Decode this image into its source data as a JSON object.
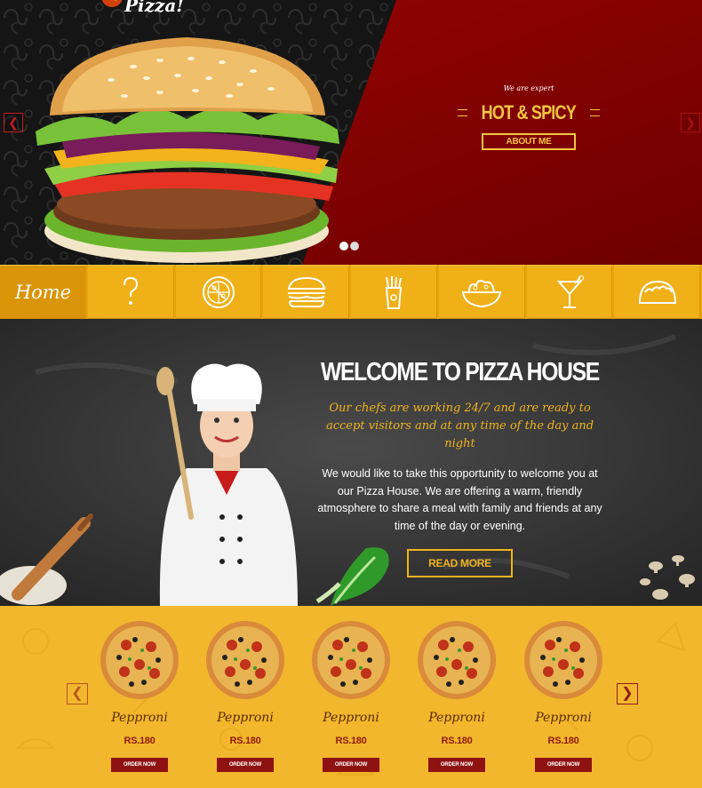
{
  "hero": {
    "logo_text": "Pizza!",
    "kicker": "We are expert",
    "title": "HOT & SPICY",
    "button_label": "ABOUT ME",
    "prev_icon": "chevron-left-icon",
    "next_icon": "chevron-right-icon",
    "slides_total": 2,
    "slide_active": 1,
    "colors": {
      "accent": "#f4c542",
      "red": "#8e0000"
    }
  },
  "categories": [
    {
      "label": "Home",
      "icon": "home-text",
      "active": true
    },
    {
      "label": "",
      "icon": "question-icon"
    },
    {
      "label": "",
      "icon": "pizza-icon"
    },
    {
      "label": "",
      "icon": "burger-icon"
    },
    {
      "label": "",
      "icon": "fries-icon"
    },
    {
      "label": "",
      "icon": "salad-bowl-icon"
    },
    {
      "label": "",
      "icon": "cocktail-icon"
    },
    {
      "label": "",
      "icon": "taco-icon"
    }
  ],
  "welcome": {
    "title": "WELCOME TO PIZZA HOUSE",
    "subtitle": "Our chefs are working 24/7 and are ready to accept visitors and at any time of the day and night",
    "body": "We would like to take this opportunity to welcome you at our Pizza House. We are offering a warm, friendly atmosphere to share a meal with family and friends at any time of the day or evening.",
    "button_label": "READ MORE",
    "colors": {
      "accent": "#f0b31e"
    }
  },
  "products": {
    "items": [
      {
        "name": "Pepproni",
        "price": "RS.180",
        "button_label": "ORDER NOW"
      },
      {
        "name": "Pepproni",
        "price": "RS.180",
        "button_label": "ORDER NOW"
      },
      {
        "name": "Pepproni",
        "price": "RS.180",
        "button_label": "ORDER NOW"
      },
      {
        "name": "Pepproni",
        "price": "RS.180",
        "button_label": "ORDER NOW"
      },
      {
        "name": "Pepproni",
        "price": "RS.180",
        "button_label": "ORDER NOW"
      }
    ],
    "prev_icon": "chevron-left-icon",
    "next_icon": "chevron-right-icon",
    "colors": {
      "background": "#f2b72c",
      "button": "#8e1212"
    }
  }
}
